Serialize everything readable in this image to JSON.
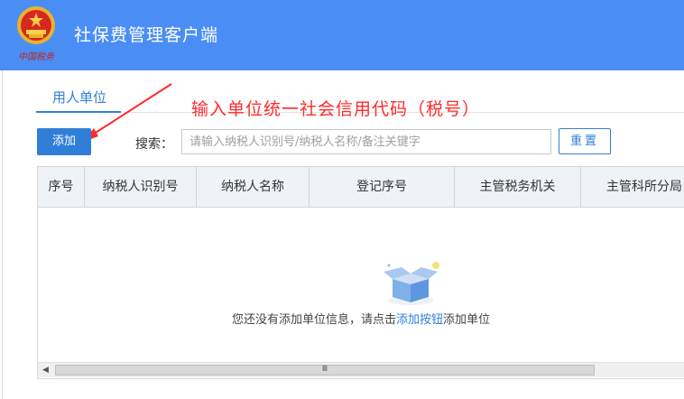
{
  "header": {
    "logo_text": "中国税务",
    "app_title": "社保费管理客户端"
  },
  "tabs": [
    {
      "label": "用人单位",
      "active": true
    }
  ],
  "annotation": "输入单位统一社会信用代码（税号）",
  "toolbar": {
    "add_label": "添加",
    "search_label": "搜索：",
    "search_placeholder": "请输入纳税人识别号/纳税人名称/备注关键字",
    "search_value": "",
    "reset_label": "重置"
  },
  "table": {
    "columns": [
      "序号",
      "纳税人识别号",
      "纳税人名称",
      "登记序号",
      "主管税务机关",
      "主管科所分局"
    ],
    "rows": [],
    "empty": {
      "before": "您还没有添加单位信息，请点击",
      "link": "添加按钮",
      "after": "添加单位"
    }
  },
  "scrollbar": {
    "left_arrow": "◀",
    "thumb_grip": "Ⅲ"
  },
  "colors": {
    "header_bg": "#4a8ef5",
    "accent": "#2f7fd8",
    "annotation": "#ff2a2a",
    "table_header_bg": "#eff2f7"
  }
}
